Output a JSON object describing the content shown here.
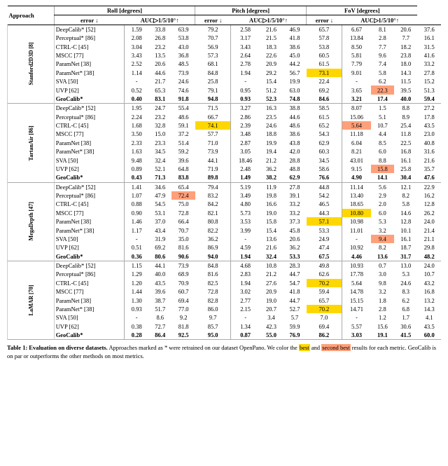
{
  "table": {
    "title": "Table 1: Evaluation on diverse datasets.",
    "caption_text": "Approaches marked as * were retrained on our dataset OpenPano. We color the",
    "caption_best": "best",
    "caption_and": "and",
    "caption_second": "second best",
    "caption_rest": "results for each metric. GeoCalib is on par or outperforms the other methods on most metrics.",
    "col_groups": [
      {
        "label": "Roll [degrees]",
        "span": 4
      },
      {
        "label": "Pitch [degrees]",
        "span": 4
      },
      {
        "label": "FoV [degrees]",
        "span": 4
      }
    ],
    "sub_cols": [
      "error ↓",
      "AUC▷1/5/10°↑",
      "error ↓",
      "AUC▷1/5/10°↑",
      "error ↓",
      "AUC▷1/5/10°↑"
    ],
    "sections": [
      {
        "dataset": "Stanford2D3D",
        "ref": "8",
        "rows": [
          {
            "approach": "DeepCalib* [52]",
            "data": [
              "1.59",
              "33.8",
              "63.9",
              "79.2",
              "2.58",
              "21.6",
              "46.9",
              "65.7",
              "6.67",
              "8.1",
              "20.6",
              "37.6"
            ],
            "highlights": []
          },
          {
            "approach": "Perceptual* [86]",
            "data": [
              "2.08",
              "26.8",
              "53.8",
              "70.7",
              "3.17",
              "21.5",
              "41.8",
              "57.8",
              "13.84",
              "2.8",
              "7.7",
              "16.1"
            ],
            "highlights": []
          },
          {
            "approach": "CTRL-C [45]",
            "data": [
              "3.04",
              "23.2",
              "43.0",
              "56.9",
              "3.43",
              "18.3",
              "38.6",
              "53.8",
              "8.50",
              "7.7",
              "18.2",
              "31.5"
            ],
            "highlights": []
          },
          {
            "approach": "MSCC [77]",
            "data": [
              "3.43",
              "13.5",
              "36.8",
              "57.3",
              "2.64",
              "22.6",
              "45.0",
              "60.5",
              "5.81",
              "9.6",
              "23.8",
              "41.6"
            ],
            "highlights": []
          },
          {
            "approach": "ParamNet [38]",
            "data": [
              "2.52",
              "20.6",
              "48.5",
              "68.1",
              "2.78",
              "20.9",
              "44.2",
              "61.5",
              "7.79",
              "7.4",
              "18.0",
              "33.2"
            ],
            "highlights": []
          },
          {
            "approach": "ParamNet* [38]",
            "data": [
              "1.14",
              "44.6",
              "73.9",
              "84.8",
              "1.94",
              "29.2",
              "56.7",
              "73.1",
              "9.01",
              "5.8",
              "14.3",
              "27.8"
            ],
            "highlights": [
              {
                "col": 7,
                "class": "highlight-b"
              }
            ]
          },
          {
            "approach": "SVA [50]",
            "data": [
              "-",
              "21.7",
              "24.6",
              "25.8",
              "-",
              "15.4",
              "19.9",
              "22.4",
              "-",
              "6.2",
              "11.5",
              "15.2"
            ],
            "highlights": []
          },
          {
            "approach": "UVP [62]",
            "data": [
              "0.52",
              "65.3",
              "74.6",
              "79.1",
              "0.95",
              "51.2",
              "63.0",
              "69.2",
              "3.65",
              "22.3",
              "39.5",
              "51.3"
            ],
            "highlights": [
              {
                "col": 9,
                "class": "highlight-s"
              }
            ]
          },
          {
            "approach": "GeoCalib*",
            "data": [
              "0.40",
              "83.1",
              "91.8",
              "94.8",
              "0.93",
              "52.3",
              "74.8",
              "84.6",
              "3.21",
              "17.4",
              "40.0",
              "59.4"
            ],
            "highlights": [],
            "bold": true
          }
        ]
      },
      {
        "dataset": "TartanAir",
        "ref": "86",
        "rows": [
          {
            "approach": "DeepCalib* [52]",
            "data": [
              "1.95",
              "24.7",
              "55.4",
              "71.5",
              "3.27",
              "16.3",
              "38.8",
              "58.5",
              "8.07",
              "1.5",
              "8.8",
              "27.2"
            ],
            "highlights": []
          },
          {
            "approach": "Perceptual* [86]",
            "data": [
              "2.24",
              "23.2",
              "48.6",
              "66.7",
              "2.86",
              "23.5",
              "44.6",
              "61.5",
              "15.06",
              "5.1",
              "8.9",
              "17.8"
            ],
            "highlights": []
          },
          {
            "approach": "CTRL-C [45]",
            "data": [
              "1.68",
              "32.8",
              "59.1",
              "74.1",
              "2.39",
              "24.6",
              "48.6",
              "65.2",
              "5.64",
              "10.7",
              "25.4",
              "43.5"
            ],
            "highlights": [
              {
                "col": 3,
                "class": "highlight-b"
              },
              {
                "col": 8,
                "class": "highlight-s"
              }
            ]
          },
          {
            "approach": "MSCC [77]",
            "data": [
              "3.50",
              "15.0",
              "37.2",
              "57.7",
              "3.48",
              "18.8",
              "38.6",
              "54.3",
              "11.18",
              "4.4",
              "11.8",
              "23.0"
            ],
            "highlights": []
          },
          {
            "approach": "ParamNet [38]",
            "data": [
              "2.33",
              "23.3",
              "51.4",
              "71.0",
              "2.87",
              "19.9",
              "43.8",
              "62.9",
              "6.04",
              "8.5",
              "22.5",
              "40.8"
            ],
            "highlights": []
          },
          {
            "approach": "ParamNet* [38]",
            "data": [
              "1.63",
              "34.5",
              "59.2",
              "73.9",
              "3.05",
              "19.4",
              "42.0",
              "60.3",
              "8.21",
              "6.0",
              "16.8",
              "31.6"
            ],
            "highlights": []
          },
          {
            "approach": "SVA [50]",
            "data": [
              "9.48",
              "32.4",
              "39.6",
              "44.1",
              "18.46",
              "21.2",
              "28.8",
              "34.5",
              "43.01",
              "8.8",
              "16.1",
              "21.6"
            ],
            "highlights": []
          },
          {
            "approach": "UVP [62]",
            "data": [
              "0.89",
              "52.1",
              "64.8",
              "71.9",
              "2.48",
              "36.2",
              "48.8",
              "58.6",
              "9.15",
              "15.8",
              "25.8",
              "35.7"
            ],
            "highlights": [
              {
                "col": 9,
                "class": "highlight-s"
              }
            ]
          },
          {
            "approach": "GeoCalib*",
            "data": [
              "0.43",
              "71.3",
              "83.8",
              "89.8",
              "1.49",
              "38.2",
              "62.9",
              "76.6",
              "4.90",
              "14.1",
              "30.4",
              "47.6"
            ],
            "highlights": [],
            "bold": true
          }
        ]
      },
      {
        "dataset": "MegaDepth",
        "ref": "47",
        "rows": [
          {
            "approach": "DeepCalib* [52]",
            "data": [
              "1.41",
              "34.6",
              "65.4",
              "79.4",
              "5.19",
              "11.9",
              "27.8",
              "44.8",
              "11.14",
              "5.6",
              "12.1",
              "22.9"
            ],
            "highlights": []
          },
          {
            "approach": "Perceptual* [86]",
            "data": [
              "1.07",
              "47.9",
              "72.4",
              "83.2",
              "3.49",
              "19.8",
              "39.1",
              "54.2",
              "13.40",
              "2.9",
              "8.2",
              "16.2"
            ],
            "highlights": [
              {
                "col": 2,
                "class": "highlight-s"
              }
            ]
          },
          {
            "approach": "CTRL-C [45]",
            "data": [
              "0.88",
              "54.5",
              "75.0",
              "84.2",
              "4.80",
              "16.6",
              "33.2",
              "46.5",
              "18.65",
              "2.0",
              "5.8",
              "12.8"
            ],
            "highlights": []
          },
          {
            "approach": "MSCC [77]",
            "data": [
              "0.90",
              "53.1",
              "72.8",
              "82.1",
              "5.73",
              "19.0",
              "33.2",
              "44.3",
              "10.80",
              "6.0",
              "14.6",
              "26.2"
            ],
            "highlights": [
              {
                "col": 8,
                "class": "highlight-b"
              }
            ]
          },
          {
            "approach": "ParamNet [38]",
            "data": [
              "1.46",
              "37.0",
              "66.4",
              "80.8",
              "3.53",
              "15.8",
              "37.3",
              "57.1",
              "10.98",
              "5.3",
              "12.8",
              "24.0"
            ],
            "highlights": [
              {
                "col": 7,
                "class": "highlight-b"
              }
            ]
          },
          {
            "approach": "ParamNet* [38]",
            "data": [
              "1.17",
              "43.4",
              "70.7",
              "82.2",
              "3.99",
              "15.4",
              "45.8",
              "53.3",
              "11.01",
              "3.2",
              "10.1",
              "21.4"
            ],
            "highlights": []
          },
          {
            "approach": "SVA [50]",
            "data": [
              "-",
              "31.9",
              "35.0",
              "36.2",
              "-",
              "13.6",
              "20.6",
              "24.9",
              "-",
              "9.4",
              "16.1",
              "21.1"
            ],
            "highlights": [
              {
                "col": 9,
                "class": "highlight-s"
              }
            ]
          },
          {
            "approach": "UVP [62]",
            "data": [
              "0.51",
              "69.2",
              "81.6",
              "86.9",
              "4.59",
              "21.6",
              "36.2",
              "47.4",
              "10.92",
              "8.2",
              "18.7",
              "29.8"
            ],
            "highlights": []
          },
          {
            "approach": "GeoCalib*",
            "data": [
              "0.36",
              "80.6",
              "90.6",
              "94.0",
              "1.94",
              "32.4",
              "53.3",
              "67.5",
              "4.46",
              "13.6",
              "31.7",
              "48.2"
            ],
            "highlights": [],
            "bold": true
          }
        ]
      },
      {
        "dataset": "LaMAR",
        "ref": "70",
        "rows": [
          {
            "approach": "DeepCalib* [52]",
            "data": [
              "1.15",
              "44.1",
              "73.9",
              "84.8",
              "4.68",
              "10.8",
              "28.3",
              "49.8",
              "10.93",
              "0.7",
              "13.0",
              "24.0"
            ],
            "highlights": []
          },
          {
            "approach": "Perceptual* [86]",
            "data": [
              "1.29",
              "40.0",
              "68.9",
              "81.6",
              "2.83",
              "21.2",
              "44.7",
              "62.6",
              "17.78",
              "3.0",
              "5.3",
              "10.7"
            ],
            "highlights": []
          },
          {
            "approach": "CTRL-C [45]",
            "data": [
              "1.20",
              "43.5",
              "70.9",
              "82.5",
              "1.94",
              "27.6",
              "54.7",
              "70.2",
              "5.64",
              "9.8",
              "24.6",
              "43.2"
            ],
            "highlights": [
              {
                "col": 7,
                "class": "highlight-b"
              }
            ]
          },
          {
            "approach": "MSCC [77]",
            "data": [
              "1.44",
              "39.6",
              "60.7",
              "72.8",
              "3.02",
              "20.9",
              "41.8",
              "59.4",
              "14.78",
              "3.2",
              "8.3",
              "16.8"
            ],
            "highlights": []
          },
          {
            "approach": "ParamNet [38]",
            "data": [
              "1.30",
              "38.7",
              "69.4",
              "82.8",
              "2.77",
              "19.0",
              "44.7",
              "65.7",
              "15.15",
              "1.8",
              "6.2",
              "13.2"
            ],
            "highlights": []
          },
          {
            "approach": "ParamNet* [38]",
            "data": [
              "0.93",
              "51.7",
              "77.0",
              "86.0",
              "2.15",
              "20.7",
              "52.7",
              "70.2",
              "14.71",
              "2.8",
              "6.8",
              "14.3"
            ],
            "highlights": [
              {
                "col": 7,
                "class": "highlight-b"
              }
            ]
          },
          {
            "approach": "SVA [50]",
            "data": [
              "-",
              "8.6",
              "9.2",
              "9.7",
              "-",
              "3.4",
              "5.7",
              "7.0",
              "-",
              "1.2",
              "1.7",
              "4.1"
            ],
            "highlights": []
          },
          {
            "approach": "UVP [62]",
            "data": [
              "0.38",
              "72.7",
              "81.8",
              "85.7",
              "1.34",
              "42.3",
              "59.9",
              "69.4",
              "5.57",
              "15.6",
              "30.6",
              "43.5"
            ],
            "highlights": []
          },
          {
            "approach": "GeoCalib*",
            "data": [
              "0.28",
              "86.4",
              "92.5",
              "95.0",
              "0.87",
              "55.0",
              "76.9",
              "86.2",
              "3.03",
              "19.1",
              "41.5",
              "60.0"
            ],
            "highlights": [],
            "bold": true
          }
        ]
      }
    ]
  }
}
